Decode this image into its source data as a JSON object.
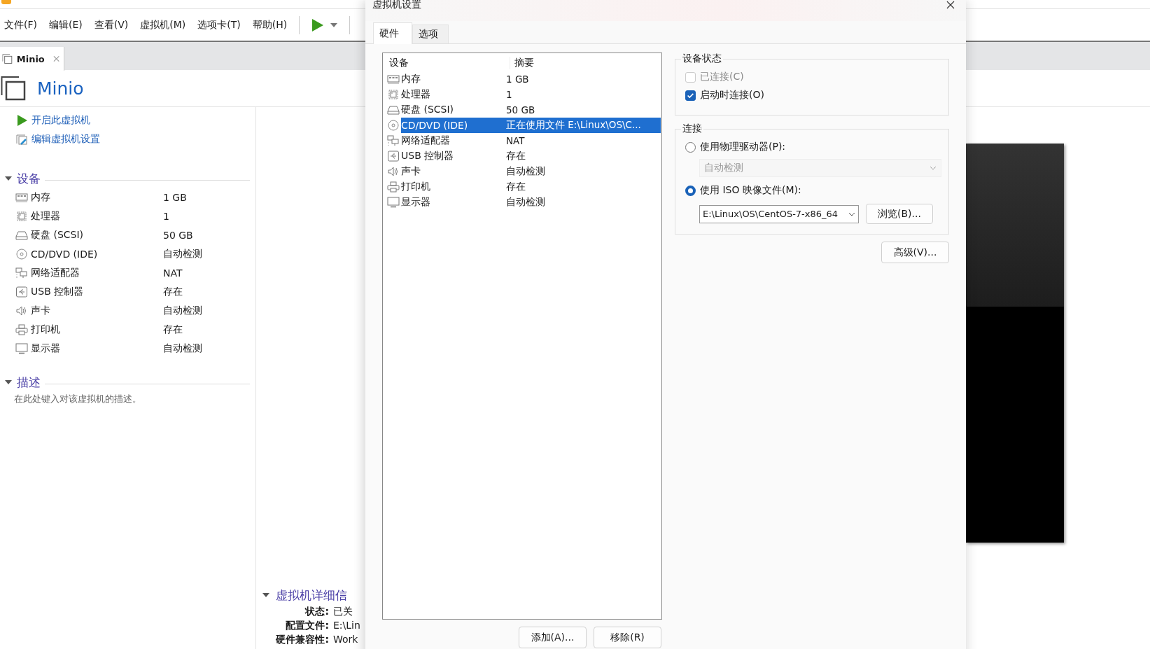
{
  "menu": [
    "文件(F)",
    "编辑(E)",
    "查看(V)",
    "虚拟机(M)",
    "选项卡(T)",
    "帮助(H)"
  ],
  "vm_tab": {
    "label": "Minio",
    "selected": true
  },
  "vm_title": "Minio",
  "actions": [
    {
      "kind": "power_on",
      "label": "开启此虚拟机"
    },
    {
      "kind": "edit",
      "label": "编辑虚拟机设置"
    }
  ],
  "devices_section": {
    "title": "设备",
    "expanded": true,
    "items": [
      {
        "kind": "memory",
        "name": "内存",
        "summary": "1 GB"
      },
      {
        "kind": "cpu",
        "name": "处理器",
        "summary": "1"
      },
      {
        "kind": "disk",
        "name": "硬盘 (SCSI)",
        "summary": "50 GB"
      },
      {
        "kind": "cd",
        "name": "CD/DVD (IDE)",
        "summary": "自动检测"
      },
      {
        "kind": "network",
        "name": "网络适配器",
        "summary": "NAT"
      },
      {
        "kind": "usb",
        "name": "USB 控制器",
        "summary": "存在"
      },
      {
        "kind": "sound",
        "name": "声卡",
        "summary": "自动检测"
      },
      {
        "kind": "printer",
        "name": "打印机",
        "summary": "存在"
      },
      {
        "kind": "display",
        "name": "显示器",
        "summary": "自动检测"
      }
    ]
  },
  "description_section": {
    "title": "描述",
    "expanded": true,
    "placeholder": "在此处键入对该虚拟机的描述。"
  },
  "details_section": {
    "title": "虚拟机详细信",
    "expanded": true,
    "rows": [
      {
        "label": "状态:",
        "value": "已关"
      },
      {
        "label": "配置文件:",
        "value": "E:\\Lin"
      },
      {
        "label": "硬件兼容性:",
        "value": "Work"
      }
    ]
  },
  "dialog": {
    "title": "虚拟机设置",
    "tabs": [
      {
        "label": "硬件",
        "selected": true
      },
      {
        "label": "选项",
        "selected": false
      }
    ],
    "hardware": {
      "columns": [
        "设备",
        "摘要"
      ],
      "rows": [
        {
          "kind": "memory",
          "name": "内存",
          "summary": "1 GB",
          "selected": false
        },
        {
          "kind": "cpu",
          "name": "处理器",
          "summary": "1",
          "selected": false
        },
        {
          "kind": "disk",
          "name": "硬盘 (SCSI)",
          "summary": "50 GB",
          "selected": false
        },
        {
          "kind": "cd",
          "name": "CD/DVD (IDE)",
          "summary": "正在使用文件 E:\\Linux\\OS\\C...",
          "selected": true
        },
        {
          "kind": "network",
          "name": "网络适配器",
          "summary": "NAT",
          "selected": false
        },
        {
          "kind": "usb",
          "name": "USB 控制器",
          "summary": "存在",
          "selected": false
        },
        {
          "kind": "sound",
          "name": "声卡",
          "summary": "自动检测",
          "selected": false
        },
        {
          "kind": "printer",
          "name": "打印机",
          "summary": "存在",
          "selected": false
        },
        {
          "kind": "display",
          "name": "显示器",
          "summary": "自动检测",
          "selected": false
        }
      ]
    },
    "buttons": [
      "添加(A)...",
      "移除(R)"
    ],
    "device_status": {
      "title": "设备状态",
      "options": [
        {
          "label": "已连接(C)",
          "checked": false,
          "disabled": true
        },
        {
          "label": "启动时连接(O)",
          "checked": true,
          "disabled": false
        }
      ]
    },
    "connection": {
      "title": "连接",
      "options": [
        {
          "label": "使用物理驱动器(P):",
          "selected": false
        },
        {
          "label": "使用 ISO 映像文件(M):",
          "selected": true
        }
      ],
      "physical_drive": {
        "value": "自动检测",
        "disabled": true
      },
      "iso_path": "E:\\Linux\\OS\\CentOS-7-x86_64",
      "browse": "浏览(B)..."
    },
    "advanced": "高级(V)..."
  }
}
